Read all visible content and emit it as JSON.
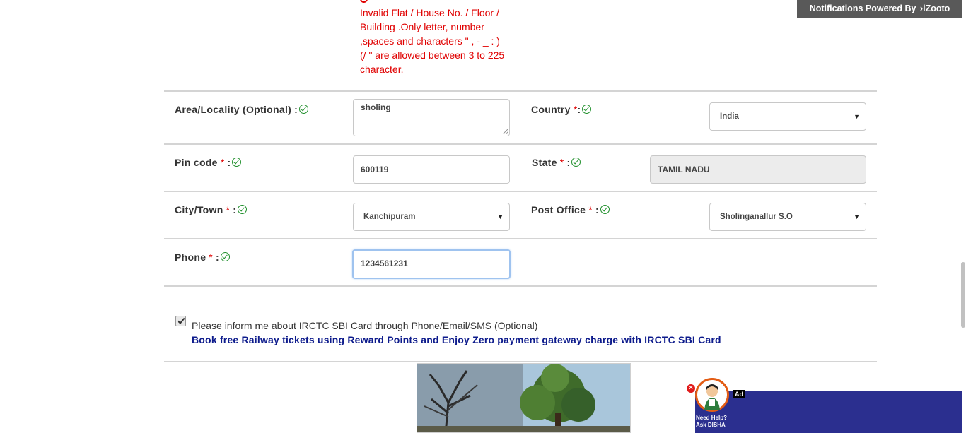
{
  "error": {
    "message": "Invalid Flat / House No. / Floor / Building .Only letter, number ,spaces and characters \" , - _ : ) (/ \" are allowed between 3 to 225 character."
  },
  "notification": {
    "text": "Notifications Powered By",
    "brand": "iZooto"
  },
  "form": {
    "area": {
      "label": "Area/Locality (Optional)",
      "value": "sholing"
    },
    "country": {
      "label": "Country",
      "value": "India"
    },
    "pincode": {
      "label": "Pin code",
      "value": "600119"
    },
    "state": {
      "label": "State",
      "value": "TAMIL NADU"
    },
    "city": {
      "label": "City/Town",
      "value": "Kanchipuram"
    },
    "postoffice": {
      "label": "Post Office",
      "value": "Sholinganallur S.O"
    },
    "phone": {
      "label": "Phone",
      "value": "1234561231"
    },
    "required_mark": "*",
    "colon": ":"
  },
  "consent": {
    "checked": true,
    "text": "Please inform me about IRCTC SBI Card through Phone/Email/SMS (Optional)",
    "link": "Book free Railway tickets using Reward Points and Enjoy Zero payment gateway charge with IRCTC SBI Card"
  },
  "disha": {
    "close_glyph": "×",
    "label_line1": "Need Help?",
    "label_line2": "Ask DISHA",
    "ad_badge": "Ad"
  },
  "colors": {
    "error": "#e00000",
    "valid_check": "#1f8f2b",
    "link": "#0d1b8c",
    "disha_panel": "#2b2f8f"
  }
}
